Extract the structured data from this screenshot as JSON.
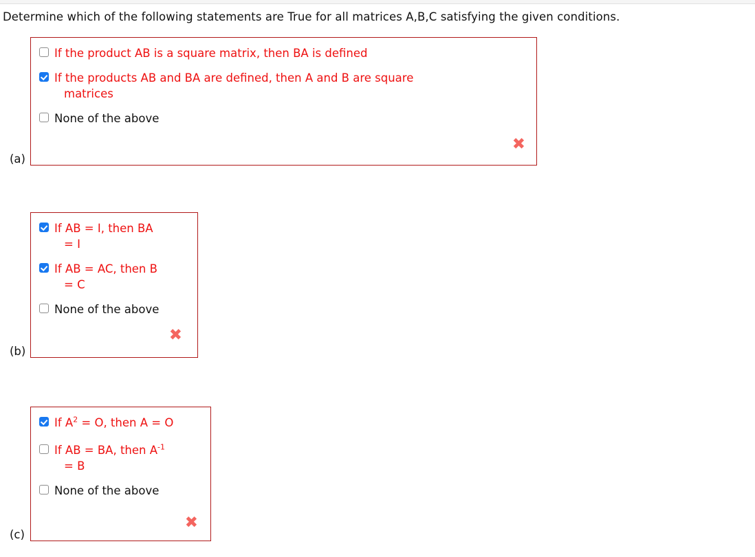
{
  "prompt": "Determine which of the following statements are True for all matrices A,B,C satisfying the given conditions.",
  "colors": {
    "statement_text": "#ee1111",
    "box_border": "#b01818",
    "checkbox_checked": "#1878f0",
    "x_mark": "#f4655f",
    "plain_text": "#121212"
  },
  "questions": [
    {
      "label": "(a)",
      "result_icon": "x-mark",
      "options": [
        {
          "checked": false,
          "text": "If the product AB is a square matrix, then BA is defined",
          "style": "statement"
        },
        {
          "checked": true,
          "text": "If the products AB and BA are defined, then A and B are square",
          "continuation": "matrices",
          "style": "statement"
        },
        {
          "checked": false,
          "text": "None of the above",
          "style": "plain"
        }
      ]
    },
    {
      "label": "(b)",
      "result_icon": "x-mark",
      "options": [
        {
          "checked": true,
          "text": "If AB = I, then BA",
          "continuation": "= I",
          "style": "statement"
        },
        {
          "checked": true,
          "text": "If AB = AC, then B",
          "continuation": "= C",
          "style": "statement"
        },
        {
          "checked": false,
          "text": "None of the above",
          "style": "plain"
        }
      ]
    },
    {
      "label": "(c)",
      "result_icon": "x-mark",
      "options": [
        {
          "checked": true,
          "text_html": "If A<sup>2</sup> = O, then A = O",
          "style": "statement"
        },
        {
          "checked": false,
          "text_html": "If AB = BA, then A<sup>-1</sup>",
          "continuation": "= B",
          "style": "statement"
        },
        {
          "checked": false,
          "text": "None of the above",
          "style": "plain"
        }
      ]
    }
  ],
  "x_glyph": "✖"
}
